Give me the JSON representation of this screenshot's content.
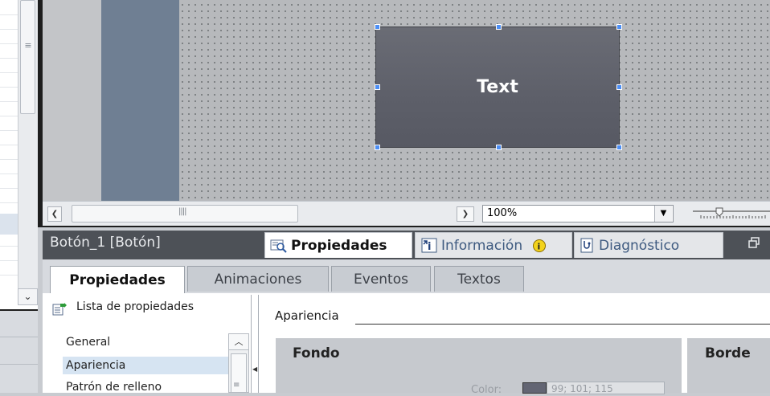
{
  "canvas": {
    "button_text": "Text"
  },
  "zoom": {
    "value": "100%"
  },
  "inspector": {
    "object_title": "Botón_1 [Botón]",
    "tabs": [
      {
        "label": "Propiedades",
        "icon": "properties-icon"
      },
      {
        "label": "Información",
        "icon": "info-icon"
      },
      {
        "label": "Diagnóstico",
        "icon": "diagnostics-icon"
      }
    ],
    "subtabs": [
      "Propiedades",
      "Animaciones",
      "Eventos",
      "Textos"
    ],
    "property_list_title": "Lista de propiedades",
    "nav_items": [
      "General",
      "Apariencia",
      "Patrón de relleno"
    ],
    "section_title": "Apariencia",
    "fondo": {
      "title": "Fondo",
      "color_label": "Color:",
      "color_value": "99; 101; 115",
      "swatch_color": "#636573"
    },
    "borde": {
      "title": "Borde"
    }
  },
  "colors": {
    "button_fill": "#5f616b",
    "handle": "#4d8ff5",
    "header_bg": "#4d5157"
  }
}
